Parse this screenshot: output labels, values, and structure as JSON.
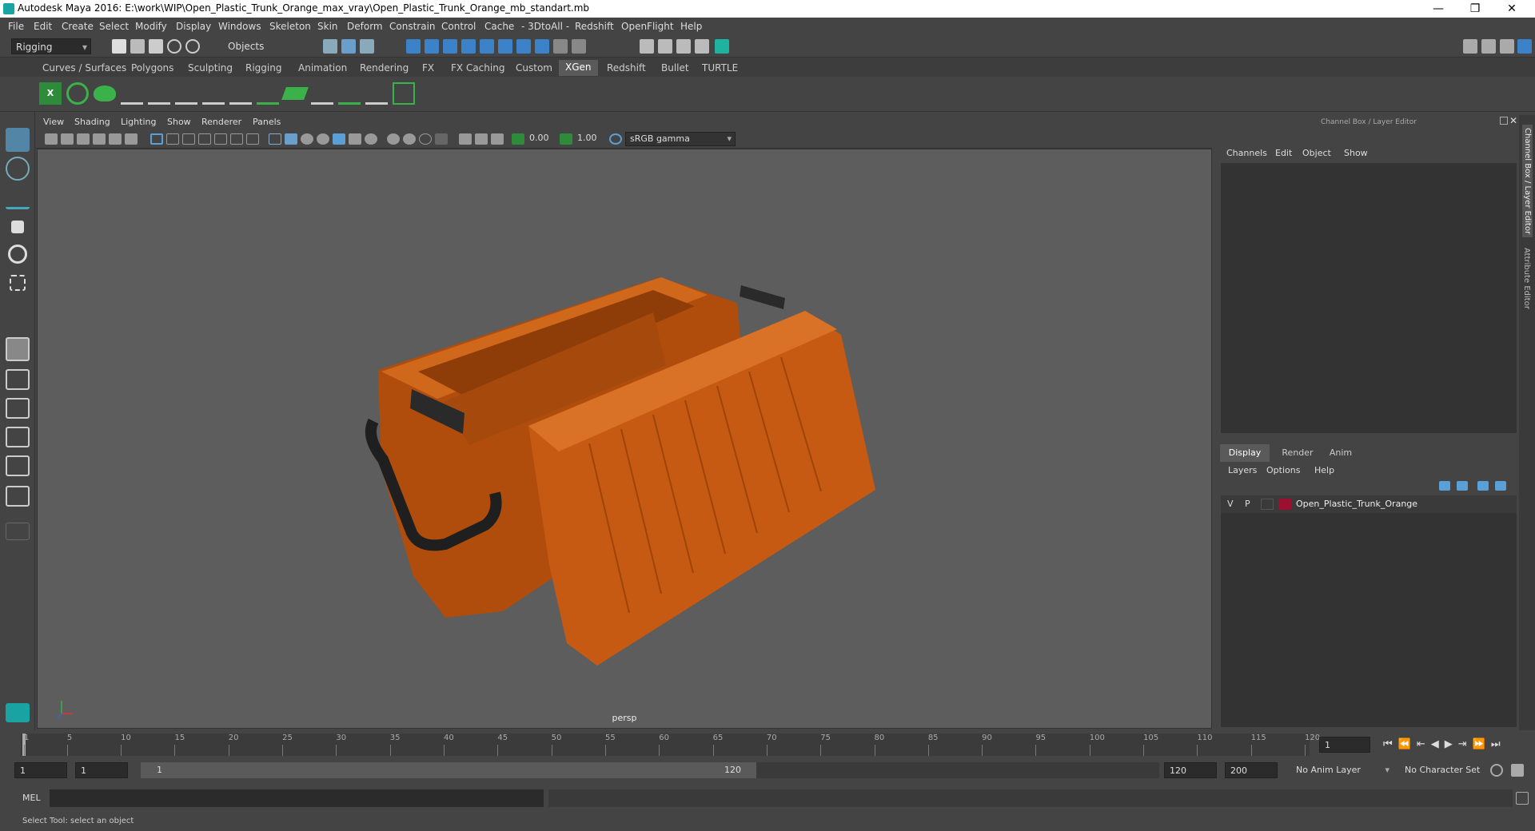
{
  "window": {
    "title": "Autodesk Maya 2016: E:\\work\\WIP\\Open_Plastic_Trunk_Orange_max_vray\\Open_Plastic_Trunk_Orange_mb_standart.mb",
    "minimize": "—",
    "restore": "❐",
    "close": "✕"
  },
  "menubar": [
    "File",
    "Edit",
    "Create",
    "Select",
    "Modify",
    "Display",
    "Windows",
    "Skeleton",
    "Skin",
    "Deform",
    "Constrain",
    "Control",
    "Cache",
    "- 3DtoAll -",
    "Redshift",
    "OpenFlight",
    "Help"
  ],
  "statusline": {
    "menuset": "Rigging",
    "selection_mode": "Objects"
  },
  "shelf_tabs": [
    "Curves / Surfaces",
    "Polygons",
    "Sculpting",
    "Rigging",
    "Animation",
    "Rendering",
    "FX",
    "FX Caching",
    "Custom",
    "XGen",
    "Redshift",
    "Bullet",
    "TURTLE"
  ],
  "active_shelf_tab": "XGen",
  "viewport": {
    "menus": [
      "View",
      "Shading",
      "Lighting",
      "Show",
      "Renderer",
      "Panels"
    ],
    "exposure": "0.00",
    "gamma": "1.00",
    "color_space": "sRGB gamma",
    "camera_label": "persp"
  },
  "channel_box": {
    "header": "Channel Box / Layer Editor",
    "menus": [
      "Channels",
      "Edit",
      "Object",
      "Show"
    ]
  },
  "layer_editor": {
    "tabs": [
      "Display",
      "Render",
      "Anim"
    ],
    "active_tab": "Display",
    "menus": [
      "Layers",
      "Options",
      "Help"
    ],
    "layers": [
      {
        "v": "V",
        "p": "P",
        "name": "Open_Plastic_Trunk_Orange",
        "color": "#9b1030"
      }
    ]
  },
  "side_tabs": [
    "Channel Box / Layer Editor",
    "Attribute Editor"
  ],
  "timeline": {
    "ticks": [
      1,
      5,
      10,
      15,
      20,
      25,
      30,
      35,
      40,
      45,
      50,
      55,
      60,
      65,
      70,
      75,
      80,
      85,
      90,
      95,
      100,
      105,
      110,
      115,
      120
    ],
    "current_frame": "1"
  },
  "range": {
    "start": "1",
    "playback_start": "1",
    "slider_start": "1",
    "slider_end": "120",
    "playback_end": "120",
    "end": "200",
    "anim_layer": "No Anim Layer",
    "character_set": "No Character Set"
  },
  "mel": {
    "label": "MEL"
  },
  "helpline": "Select Tool: select an object",
  "colors": {
    "trunk": "#c65a12",
    "accent_tab": "#5a5a5a",
    "layer_swatch": "#9b1030"
  }
}
